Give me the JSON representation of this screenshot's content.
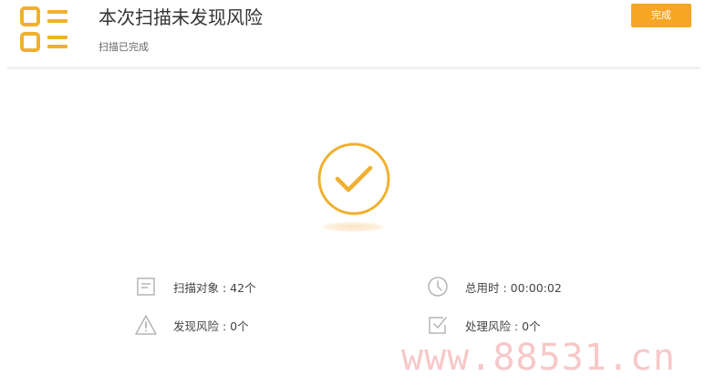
{
  "header": {
    "title": "本次扫描未发现风险",
    "subtitle": "扫描已完成",
    "done_button": "完成",
    "app_icon": "list-icon"
  },
  "result": {
    "status_icon": "check-circle-icon"
  },
  "stats": {
    "scanned_objects": "扫描对象 : 42个",
    "total_time": "总用时 : 00:00:02",
    "risks_found": "发现风险 : 0个",
    "risks_handled": "处理风险 : 0个"
  },
  "icons": {
    "scanned_objects": "document-icon",
    "total_time": "clock-icon",
    "risks_found": "warning-icon",
    "risks_handled": "checkbox-icon"
  },
  "colors": {
    "accent": "#f6a623",
    "check": "#f0b02f",
    "icon_gray": "#b5b5b5"
  },
  "watermark": "www.88531.cn"
}
